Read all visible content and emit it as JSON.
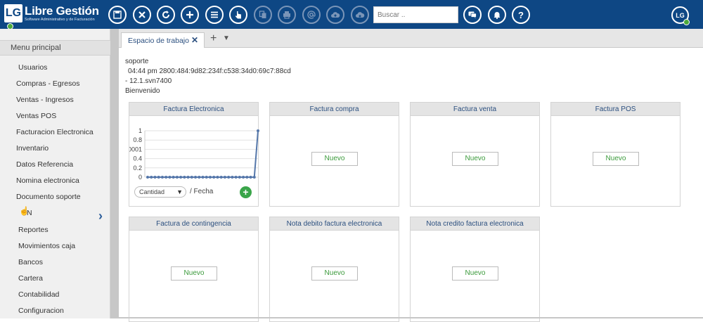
{
  "app": {
    "logo_mark": "LG",
    "title": "Libre Gestión",
    "subtitle": "Software Administrativo y de Facturación"
  },
  "toolbar": {
    "icons": [
      "save-icon",
      "cancel-icon",
      "refresh-icon",
      "add-icon",
      "list-icon",
      "pointer-icon",
      "copy-icon",
      "print-icon",
      "email-icon",
      "cloud-upload-icon",
      "cloud-download-icon"
    ],
    "search_placeholder": "Buscar ..",
    "right_icons": [
      "chat-icon",
      "bell-icon",
      "help-icon"
    ],
    "help_glyph": "?",
    "user_badge": "LG"
  },
  "sidebar": {
    "header": "Menu principal",
    "items": [
      "Usuarios",
      "Compras - Egresos",
      "Ventas - Ingresos",
      "Ventas POS",
      "Facturacion Electronica",
      "Inventario",
      "Datos Referencia",
      "Nomina electronica",
      "Documento soporte",
      "N",
      "Reportes",
      "Movimientos caja",
      "Bancos",
      "Cartera",
      "Contabilidad",
      "Configuracion"
    ]
  },
  "tabs": {
    "active_label": "Espacio de trabajo",
    "close_glyph": "✕",
    "add_glyph": "+",
    "more_glyph": "▼"
  },
  "info": {
    "user": "soporte",
    "session": "04:44 pm  2800:484:9d82:234f:c538:34d0:69c7:88cd",
    "version": "-  12.1.svn7400",
    "welcome": "Bienvenido"
  },
  "panels": [
    {
      "title": "Factura Electronica"
    },
    {
      "title": "Factura compra",
      "button": "Nuevo"
    },
    {
      "title": "Factura venta",
      "button": "Nuevo"
    },
    {
      "title": "Factura POS",
      "button": "Nuevo"
    },
    {
      "title": "Factura de contingencia",
      "button": "Nuevo"
    },
    {
      "title": "Nota debito factura electronica",
      "button": "Nuevo"
    },
    {
      "title": "Nota credito factura electronica",
      "button": "Nuevo"
    }
  ],
  "chart_widget": {
    "select_value": "Cantidad",
    "x_label": "/ Fecha",
    "add_glyph": "+"
  },
  "chart_data": {
    "type": "line",
    "y_ticks": [
      "1",
      "0.8",
      "0.6",
      "0.4",
      "0.2",
      "0"
    ],
    "y_tick_display": [
      "1",
      "0.8",
      "0001",
      "0.4",
      "0.2",
      "0"
    ],
    "ylim": [
      0,
      1
    ],
    "series": [
      {
        "values": [
          0,
          0,
          0,
          0,
          0,
          0,
          0,
          0,
          0,
          0,
          0,
          0,
          0,
          0,
          0,
          0,
          0,
          0,
          0,
          0,
          0,
          0,
          0,
          0,
          0,
          0,
          0,
          0,
          0,
          0,
          1
        ]
      }
    ],
    "color": "#5577aa",
    "grid": true
  }
}
